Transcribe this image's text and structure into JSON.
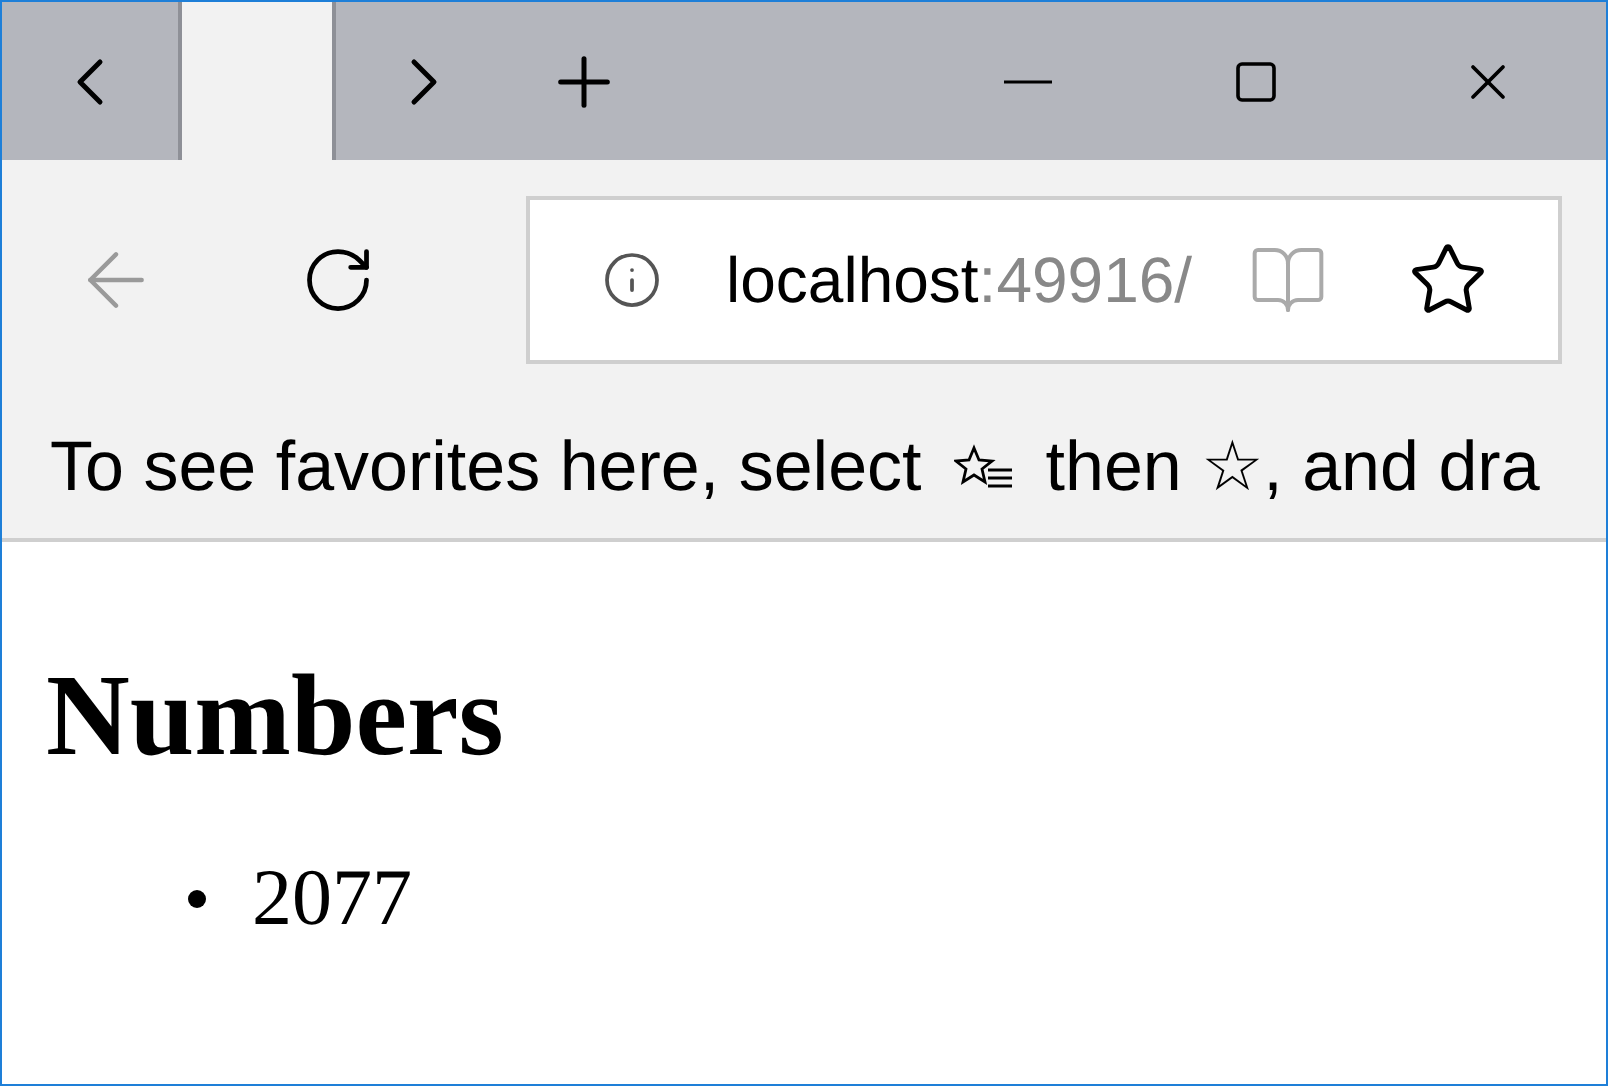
{
  "tabs": [
    {
      "selected": true
    }
  ],
  "address": {
    "host": "localhost",
    "port": ":49916/"
  },
  "favorites_bar": {
    "text_before": "To see favorites here, select",
    "text_after": "then ☆, and dra"
  },
  "page": {
    "heading": "Numbers",
    "items": [
      "2077"
    ]
  }
}
